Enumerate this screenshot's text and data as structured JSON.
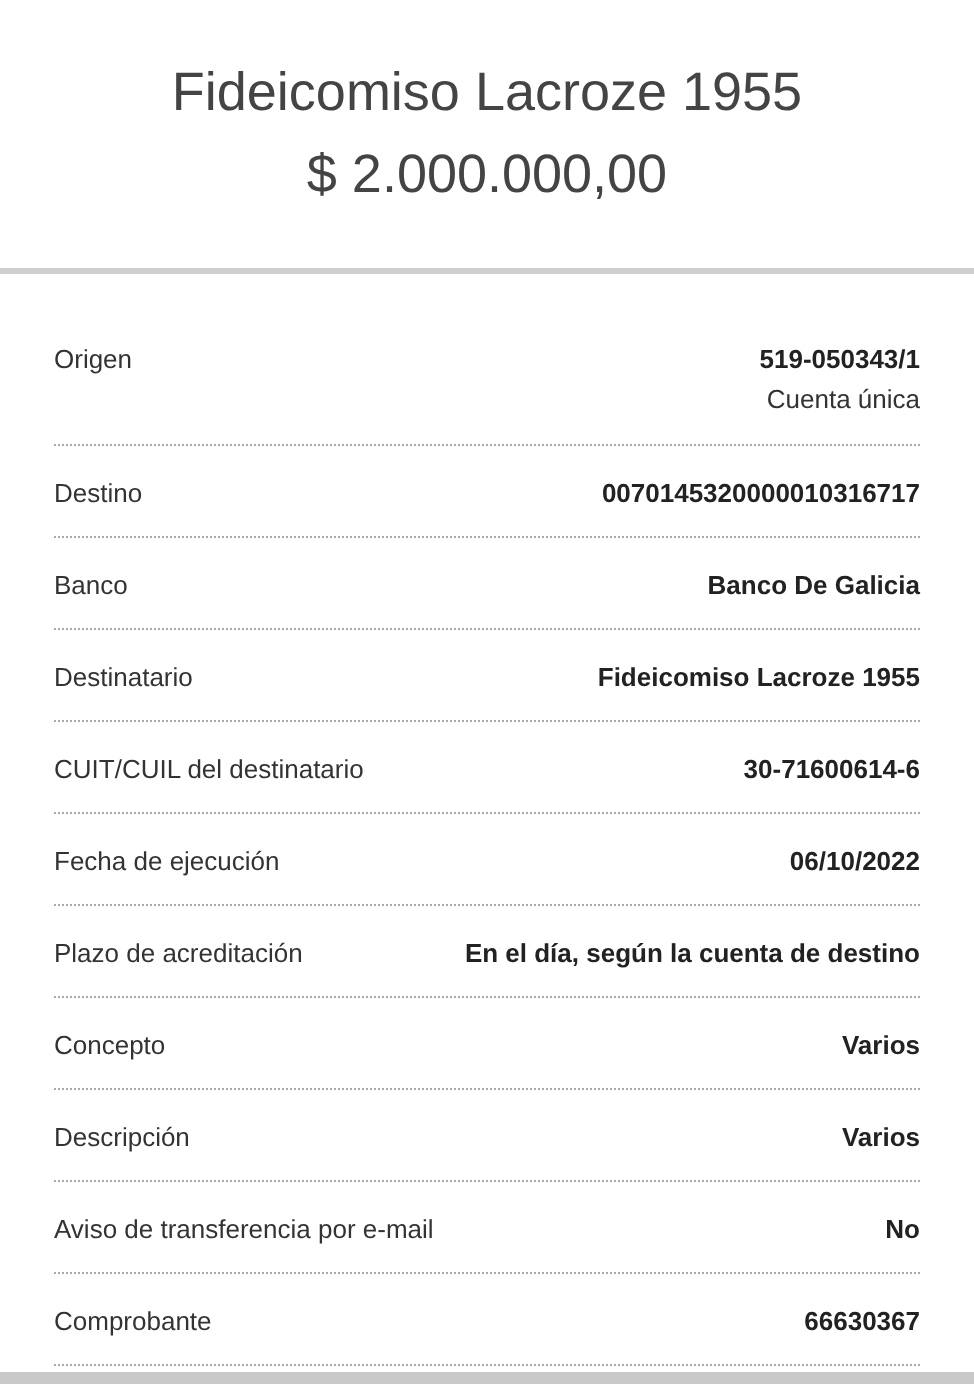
{
  "header": {
    "title": "Fideicomiso Lacroze 1955",
    "amount": "$ 2.000.000,00"
  },
  "rows": [
    {
      "label": "Origen",
      "value": "519-050343/1",
      "note": "Cuenta única"
    },
    {
      "label": "Destino",
      "value": "0070145320000010316717"
    },
    {
      "label": "Banco",
      "value": "Banco De Galicia"
    },
    {
      "label": "Destinatario",
      "value": "Fideicomiso Lacroze 1955"
    },
    {
      "label": "CUIT/CUIL del destinatario",
      "value": "30-71600614-6"
    },
    {
      "label": "Fecha de ejecución",
      "value": "06/10/2022"
    },
    {
      "label": "Plazo de acreditación",
      "value": "En el día, según la cuenta de destino"
    },
    {
      "label": "Concepto",
      "value": "Varios"
    },
    {
      "label": "Descripción",
      "value": "Varios"
    },
    {
      "label": "Aviso de transferencia por e-mail",
      "value": "No"
    },
    {
      "label": "Comprobante",
      "value": "66630367"
    }
  ]
}
